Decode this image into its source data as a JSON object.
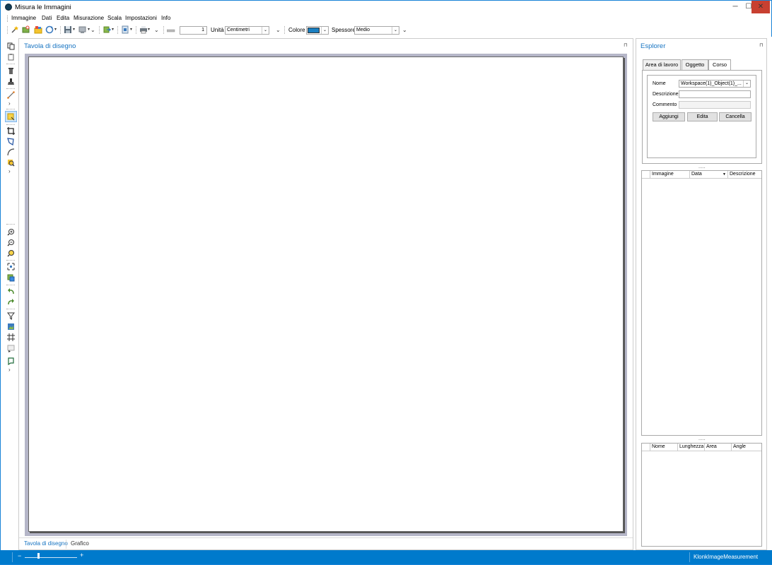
{
  "window": {
    "title": "Misura le Immagini",
    "minimize": "─",
    "maximize": "☐",
    "close": "✕"
  },
  "menu": [
    "Immagine",
    "Dati",
    "Edita",
    "Misurazione",
    "Scala",
    "Impostazioni",
    "Info"
  ],
  "toolbar": {
    "line_value": "1",
    "unit_label": "Unità",
    "unit_value": "Centimetri",
    "color_label": "Colore",
    "color_value": "#1a7fc1",
    "thickness_label": "Spessore",
    "thickness_value": "Medio"
  },
  "board": {
    "title": "Tavola di disegno",
    "pin": "⊓",
    "tabs": [
      "Tavola di disegno",
      "Grafico"
    ]
  },
  "explorer": {
    "title": "Esplorer",
    "pin": "⊓",
    "tabs": [
      "Area di lavoro",
      "Oggetto",
      "Corso"
    ],
    "form": {
      "name_label": "Nome",
      "name_value": "Workspace(1)_Object(1)_...",
      "desc_label": "Descrizione",
      "desc_value": "",
      "comment_label": "Commento",
      "comment_value": "",
      "add_button": "Aggiungi",
      "edit_button": "Edita",
      "delete_button": "Cancella"
    },
    "splitter": ".....",
    "image_grid": {
      "columns": [
        "Immagine",
        "Data",
        "Descrizione"
      ],
      "rows": []
    },
    "measure_grid": {
      "columns": [
        "Nome",
        "Lunghezza",
        "Area",
        "Angle"
      ],
      "rows": []
    }
  },
  "statusbar": {
    "minus": "−",
    "plus": "+",
    "zoom_value": 0.26,
    "app_name": "KlonkImageMeasurement"
  },
  "colors": {
    "accent": "#007acc",
    "title_link": "#1774c2",
    "close": "#c84031",
    "canvas_bg": "#b5b6c8"
  }
}
